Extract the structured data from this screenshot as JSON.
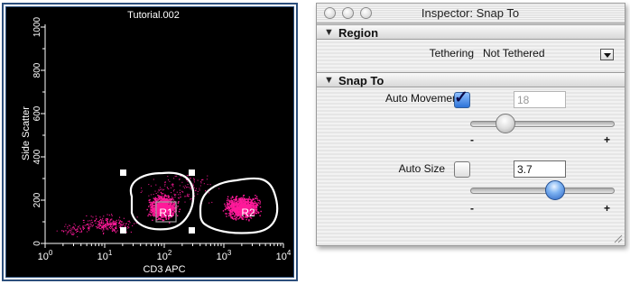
{
  "plot": {
    "title": "Tutorial.002",
    "x_axis_label": "CD3 APC",
    "y_axis_label": "Side Scatter",
    "x_ticks": [
      {
        "base": "10",
        "exp": "0"
      },
      {
        "base": "10",
        "exp": "1"
      },
      {
        "base": "10",
        "exp": "2"
      },
      {
        "base": "10",
        "exp": "3"
      },
      {
        "base": "10",
        "exp": "4"
      }
    ],
    "y_ticks": [
      "0",
      "200",
      "400",
      "600",
      "800",
      "1000"
    ],
    "regions": [
      {
        "label": "R1",
        "color": "#ffffff"
      },
      {
        "label": "R2",
        "color": "#ffffff"
      }
    ],
    "dot_color": "#ff1a9a",
    "background": "#000000"
  },
  "inspector": {
    "title": "Inspector: Snap To",
    "sections": {
      "region": {
        "header": "Region",
        "tethering_label": "Tethering",
        "tethering_value": "Not Tethered"
      },
      "snap_to": {
        "header": "Snap To",
        "auto_movement_label": "Auto Movement",
        "auto_movement_checked": true,
        "auto_movement_value": "18",
        "auto_movement_slider_level": 0.2,
        "auto_size_label": "Auto Size",
        "auto_size_checked": false,
        "auto_size_value": "3.7",
        "auto_size_slider_level": 0.6,
        "minus_label": "-",
        "plus_label": "+"
      }
    }
  }
}
